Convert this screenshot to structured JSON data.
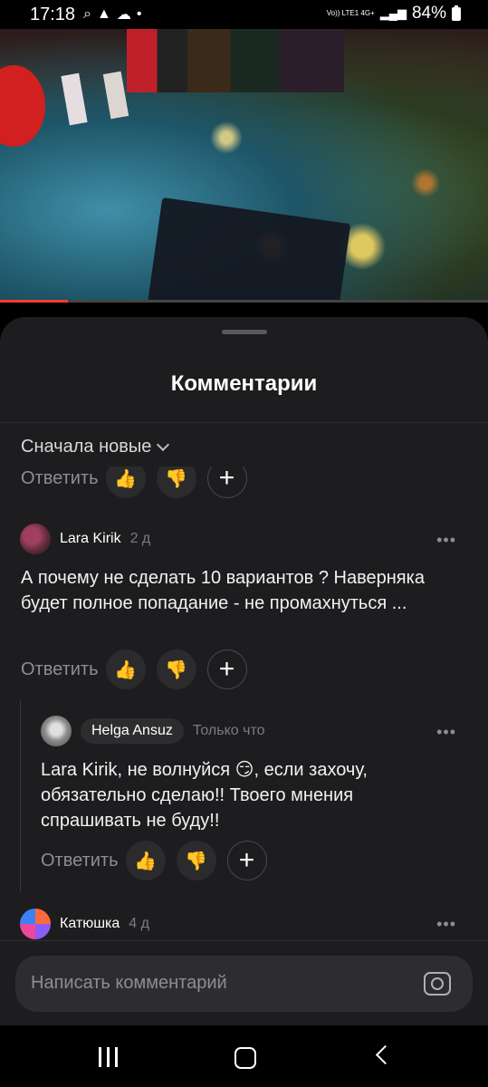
{
  "status_bar": {
    "time": "17:18",
    "network": "Vo)) LTE1 4G+",
    "battery": "84%"
  },
  "video": {
    "progress_fraction": 0.14
  },
  "sheet": {
    "title": "Комментарии",
    "sort_label": "Сначала новые"
  },
  "actions": {
    "reply_label": "Ответить"
  },
  "comments": [
    {
      "author": "Lara Kirik",
      "date": "2 д",
      "text": "А почему не сделать 10 вариантов ? Наверняка будет полное попадание  - не промахнуться ..."
    },
    {
      "author": "Helga Ansuz",
      "date": "Только что",
      "text": "Lara Kirik, не волнуйся 😏, если захочу, обязательно сделаю!! Твоего мнения спрашивать не буду!!"
    },
    {
      "author": "Катюшка",
      "date": "4 д",
      "text": ""
    }
  ],
  "composer": {
    "placeholder": "Написать комментарий"
  },
  "icons": {
    "like": "👍",
    "dislike": "👎",
    "more": "•••"
  },
  "colors": {
    "sheet_bg": "#1d1d1f",
    "progress": "#ff3d2e"
  }
}
